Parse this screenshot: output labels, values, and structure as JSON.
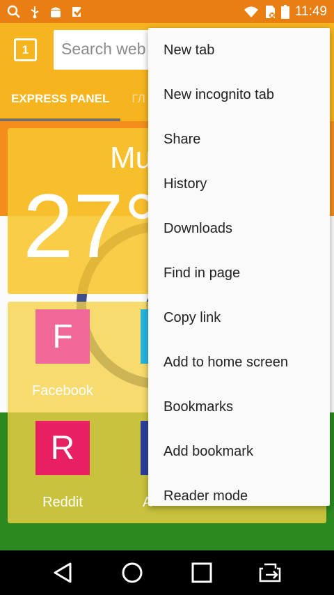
{
  "status_bar": {
    "time": "11:49",
    "left_icons": [
      "search-icon",
      "usb-icon",
      "android-icon",
      "checkmark-icon"
    ],
    "right_icons": [
      "wifi-icon",
      "sim-off-icon",
      "battery-icon"
    ]
  },
  "toolbar": {
    "tab_count": "1",
    "search_placeholder": "Search web"
  },
  "tabs": [
    {
      "label": "EXPRESS PANEL"
    },
    {
      "label": "ГЛ"
    }
  ],
  "weather": {
    "city": "Mu",
    "temperature": "27°"
  },
  "speed_dial": [
    {
      "letter": "F",
      "label": "Facebook",
      "color": "#f0679a"
    },
    {
      "letter": "",
      "label": "",
      "color": "#27b6de"
    },
    {
      "letter": "R",
      "label": "Reddit",
      "color": "#e81f63"
    },
    {
      "letter": "",
      "label": "A",
      "color": "#2d3f9c"
    }
  ],
  "menu": {
    "items": [
      {
        "label": "New tab"
      },
      {
        "label": "New incognito tab"
      },
      {
        "label": "Share"
      },
      {
        "label": "History"
      },
      {
        "label": "Downloads"
      },
      {
        "label": "Find in page"
      },
      {
        "label": "Copy link"
      },
      {
        "label": "Add to home screen"
      },
      {
        "label": "Bookmarks"
      },
      {
        "label": "Add bookmark"
      },
      {
        "label": "Reader mode"
      }
    ]
  },
  "nav": {
    "buttons": [
      "back-icon",
      "home-icon",
      "recents-icon",
      "tab-switch-icon"
    ]
  },
  "colors": {
    "status_bar": "#e97f12",
    "toolbar": "#f6b51f",
    "flag_orange": "#f38e1d",
    "flag_green": "#2a8a1f",
    "chakra": "#1c2e78"
  }
}
